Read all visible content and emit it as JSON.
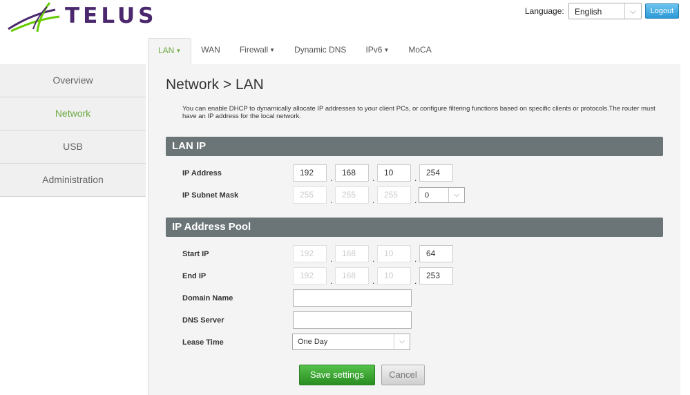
{
  "header": {
    "brand": "TELUS",
    "brand_colors": {
      "purple": "#4b286d",
      "green": "#66cc00"
    },
    "language_label": "Language:",
    "language_value": "English",
    "logout_label": "Logout"
  },
  "tabs": [
    {
      "label": "LAN",
      "has_dropdown": true,
      "active": true
    },
    {
      "label": "WAN",
      "has_dropdown": false,
      "active": false
    },
    {
      "label": "Firewall",
      "has_dropdown": true,
      "active": false
    },
    {
      "label": "Dynamic DNS",
      "has_dropdown": false,
      "active": false
    },
    {
      "label": "IPv6",
      "has_dropdown": true,
      "active": false
    },
    {
      "label": "MoCA",
      "has_dropdown": false,
      "active": false
    }
  ],
  "sidebar": {
    "items": [
      {
        "label": "Overview",
        "active": false
      },
      {
        "label": "Network",
        "active": true
      },
      {
        "label": "USB",
        "active": false
      },
      {
        "label": "Administration",
        "active": false
      }
    ]
  },
  "page": {
    "title": "Network > LAN",
    "description": "You can enable DHCP to dynamically allocate IP addresses to your client PCs, or configure filtering functions based on specific clients or protocols.The router must have an IP address for the local network."
  },
  "lan_ip": {
    "section_title": "LAN IP",
    "ip_address_label": "IP Address",
    "ip_address": [
      "192",
      "168",
      "10",
      "254"
    ],
    "subnet_mask_label": "IP Subnet Mask",
    "subnet_mask": [
      "255",
      "255",
      "255"
    ],
    "subnet_last_value": "0"
  },
  "pool": {
    "section_title": "IP Address Pool",
    "start_ip_label": "Start IP",
    "start_ip": [
      "192",
      "168",
      "10",
      "64"
    ],
    "end_ip_label": "End IP",
    "end_ip": [
      "192",
      "168",
      "10",
      "253"
    ],
    "domain_name_label": "Domain Name",
    "domain_name_value": "",
    "dns_server_label": "DNS Server",
    "dns_server_value": "",
    "lease_time_label": "Lease Time",
    "lease_time_value": "One Day"
  },
  "actions": {
    "save_label": "Save settings",
    "cancel_label": "Cancel"
  },
  "icons": {
    "dropdown_caret": "chevron-down-icon",
    "tab_caret": "caret-down-icon"
  },
  "colors": {
    "accent_green": "#6da942",
    "section_bar": "#6b7577",
    "logout_blue": "#2a9ad6",
    "save_green": "#3ba531"
  }
}
